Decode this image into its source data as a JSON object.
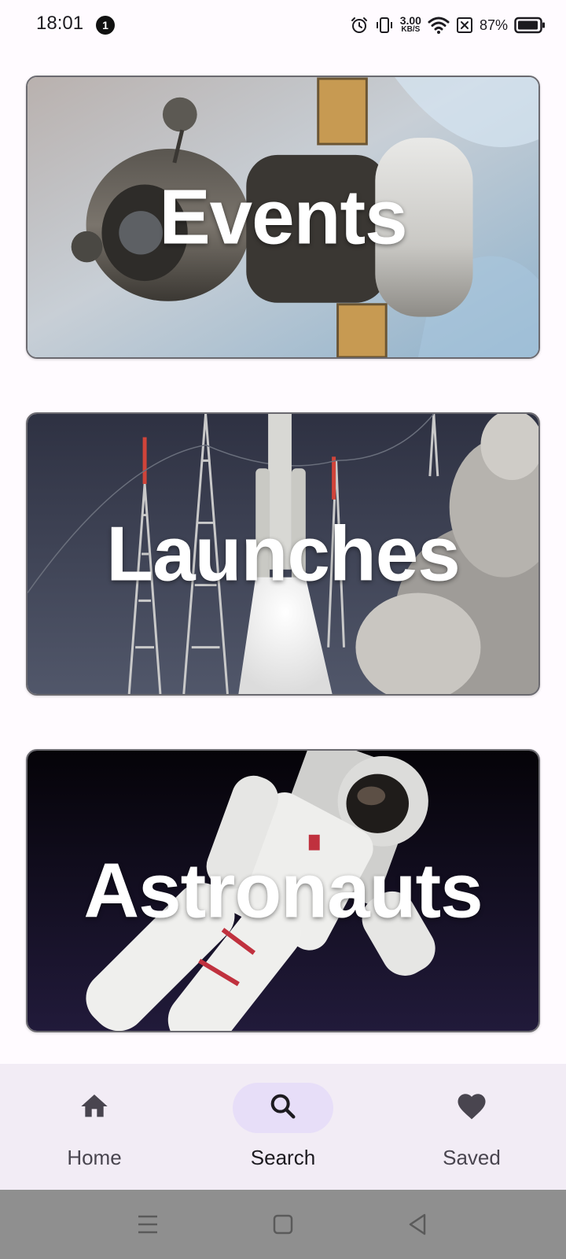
{
  "status_bar": {
    "time": "18:01",
    "notification_count": "1",
    "net_speed_value": "3.00",
    "net_speed_unit": "KB/S",
    "battery_percent": "87%"
  },
  "cards": [
    {
      "title": "Events"
    },
    {
      "title": "Launches"
    },
    {
      "title": "Astronauts"
    }
  ],
  "bottom_nav": {
    "items": [
      {
        "label": "Home",
        "icon": "home-icon",
        "active": false
      },
      {
        "label": "Search",
        "icon": "search-icon",
        "active": true
      },
      {
        "label": "Saved",
        "icon": "heart-icon",
        "active": false
      }
    ]
  },
  "colors": {
    "background": "#fffbff",
    "nav_background": "#f2ecf5",
    "active_pill": "#e7def8",
    "system_nav": "#8f8f8f"
  }
}
